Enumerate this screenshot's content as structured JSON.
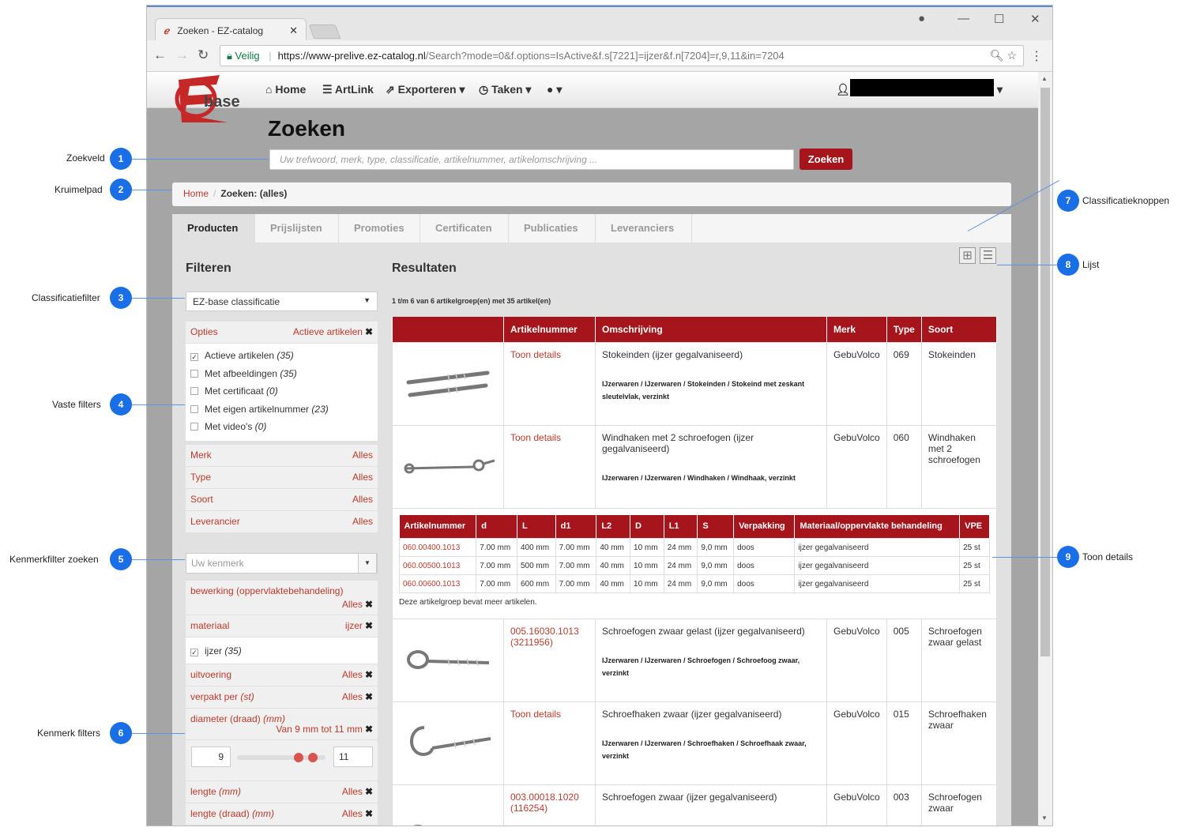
{
  "browser": {
    "tab_title": "Zoeken - EZ-catalog",
    "secure_label": "Veilig",
    "url_host": "https://www-prelive.ez-catalog.nl",
    "url_path": "/Search?mode=0&f.options=IsActive&f.s[7221]=ijzer&f.n[7204]=r,9,11&in=7204"
  },
  "nav": {
    "logo_text": "base",
    "items": [
      "Home",
      "ArtLink",
      "Exporteren",
      "Taken"
    ]
  },
  "search": {
    "title": "Zoeken",
    "placeholder": "Uw trefwoord, merk, type, classificatie, artikelnummer, artikelomschrijving ...",
    "button": "Zoeken"
  },
  "breadcrumb": {
    "home": "Home",
    "current": "Zoeken: (alles)"
  },
  "tabs": [
    "Producten",
    "Prijslijsten",
    "Promoties",
    "Certificaten",
    "Publicaties",
    "Leveranciers"
  ],
  "filters": {
    "title": "Filteren",
    "classification": "EZ-base classificatie",
    "options_label": "Opties",
    "options_active": "Actieve artikelen",
    "options": [
      {
        "label": "Actieve artikelen",
        "count": "(35)",
        "checked": true
      },
      {
        "label": "Met afbeeldingen",
        "count": "(35)",
        "checked": false
      },
      {
        "label": "Met certificaat",
        "count": "(0)",
        "checked": false
      },
      {
        "label": "Met eigen artikelnummer",
        "count": "(23)",
        "checked": false
      },
      {
        "label": "Met video's",
        "count": "(0)",
        "checked": false
      }
    ],
    "simple": [
      {
        "label": "Merk",
        "value": "Alles"
      },
      {
        "label": "Type",
        "value": "Alles"
      },
      {
        "label": "Soort",
        "value": "Alles"
      },
      {
        "label": "Leverancier",
        "value": "Alles"
      }
    ],
    "kenmerk_placeholder": "Uw kenmerk",
    "kenmerken": {
      "bewerking": {
        "label": "bewerking (oppervlaktebehandeling)",
        "value": "Alles"
      },
      "materiaal": {
        "label": "materiaal",
        "value": "ijzer",
        "option": "ijzer",
        "count": "(35)"
      },
      "uitvoering": {
        "label": "uitvoering",
        "value": "Alles"
      },
      "verpakt": {
        "label": "verpakt per",
        "unit": "(st)",
        "value": "Alles"
      },
      "diameter": {
        "label": "diameter (draad)",
        "unit": "(mm)",
        "value": "Van 9 mm tot 11 mm",
        "min": "9",
        "max": "11"
      },
      "lengte": {
        "label": "lengte",
        "unit": "(mm)",
        "value": "Alles"
      },
      "lengte_draad": {
        "label": "lengte (draad)",
        "unit": "(mm)",
        "value": "Alles"
      }
    }
  },
  "results": {
    "title": "Resultaten",
    "count": "1 t/m 6 van 6 artikelgroep(en) met 35 artikel(en)",
    "columns": [
      "",
      "Artikelnummer",
      "Omschrijving",
      "Merk",
      "Type",
      "Soort"
    ],
    "rows": [
      {
        "nummer": "Toon details",
        "omschrijving": "Stokeinden (ijzer gegalvaniseerd)",
        "pad": "IJzerwaren / IJzerwaren / Stokeinden / Stokeind met zeskant sleutelvlak, verzinkt",
        "merk": "GebuVolco",
        "type": "069",
        "soort": "Stokeinden"
      },
      {
        "nummer": "Toon details",
        "omschrijving": "Windhaken met 2 schroefogen (ijzer gegalvaniseerd)",
        "pad": "IJzerwaren / IJzerwaren / Windhaken / Windhaak, verzinkt",
        "merk": "GebuVolco",
        "type": "060",
        "soort": "Windhaken met 2 schroefogen"
      },
      {
        "nummer": "005.16030.1013 (3211956)",
        "omschrijving": "Schroefogen zwaar gelast (ijzer gegalvaniseerd)",
        "pad": "IJzerwaren / IJzerwaren / Schroefogen / Schroefoog zwaar, verzinkt",
        "merk": "GebuVolco",
        "type": "005",
        "soort": "Schroefogen zwaar gelast"
      },
      {
        "nummer": "Toon details",
        "omschrijving": "Schroefhaken zwaar (ijzer gegalvaniseerd)",
        "pad": "IJzerwaren / IJzerwaren / Schroefhaken / Schroefhaak zwaar, verzinkt",
        "merk": "GebuVolco",
        "type": "015",
        "soort": "Schroefhaken zwaar"
      },
      {
        "nummer": "003.00018.1020 (116254)",
        "omschrijving": "Schroefogen zwaar (ijzer gegalvaniseerd)",
        "pad": "",
        "merk": "GebuVolco",
        "type": "003",
        "soort": "Schroefogen zwaar"
      }
    ],
    "sub": {
      "columns": [
        "Artikelnummer",
        "d",
        "L",
        "d1",
        "L2",
        "D",
        "L1",
        "S",
        "Verpakking",
        "Materiaal/oppervlakte behandeling",
        "VPE"
      ],
      "rows": [
        [
          "060.00400.1013",
          "7.00 mm",
          "400 mm",
          "7.00 mm",
          "40 mm",
          "10 mm",
          "24 mm",
          "9,0 mm",
          "doos",
          "ijzer gegalvaniseerd",
          "25 st"
        ],
        [
          "060.00500.1013",
          "7.00 mm",
          "500 mm",
          "7.00 mm",
          "40 mm",
          "10 mm",
          "24 mm",
          "9,0 mm",
          "doos",
          "ijzer gegalvaniseerd",
          "25 st"
        ],
        [
          "060.00600.1013",
          "7.00 mm",
          "600 mm",
          "7.00 mm",
          "40 mm",
          "10 mm",
          "24 mm",
          "9,0 mm",
          "doos",
          "ijzer gegalvaniseerd",
          "25 st"
        ]
      ],
      "note": "Deze artikelgroep bevat meer artikelen."
    }
  },
  "annotations": {
    "left": [
      {
        "n": "1",
        "label": "Zoekveld"
      },
      {
        "n": "2",
        "label": "Kruimelpad"
      },
      {
        "n": "3",
        "label": "Classificatiefilter"
      },
      {
        "n": "4",
        "label": "Vaste filters"
      },
      {
        "n": "5",
        "label": "Kenmerkfilter zoeken"
      },
      {
        "n": "6",
        "label": "Kenmerk filters"
      }
    ],
    "right": [
      {
        "n": "7",
        "label": "Classificatieknoppen"
      },
      {
        "n": "8",
        "label": "Lijst"
      },
      {
        "n": "9",
        "label": "Toon details"
      }
    ]
  }
}
